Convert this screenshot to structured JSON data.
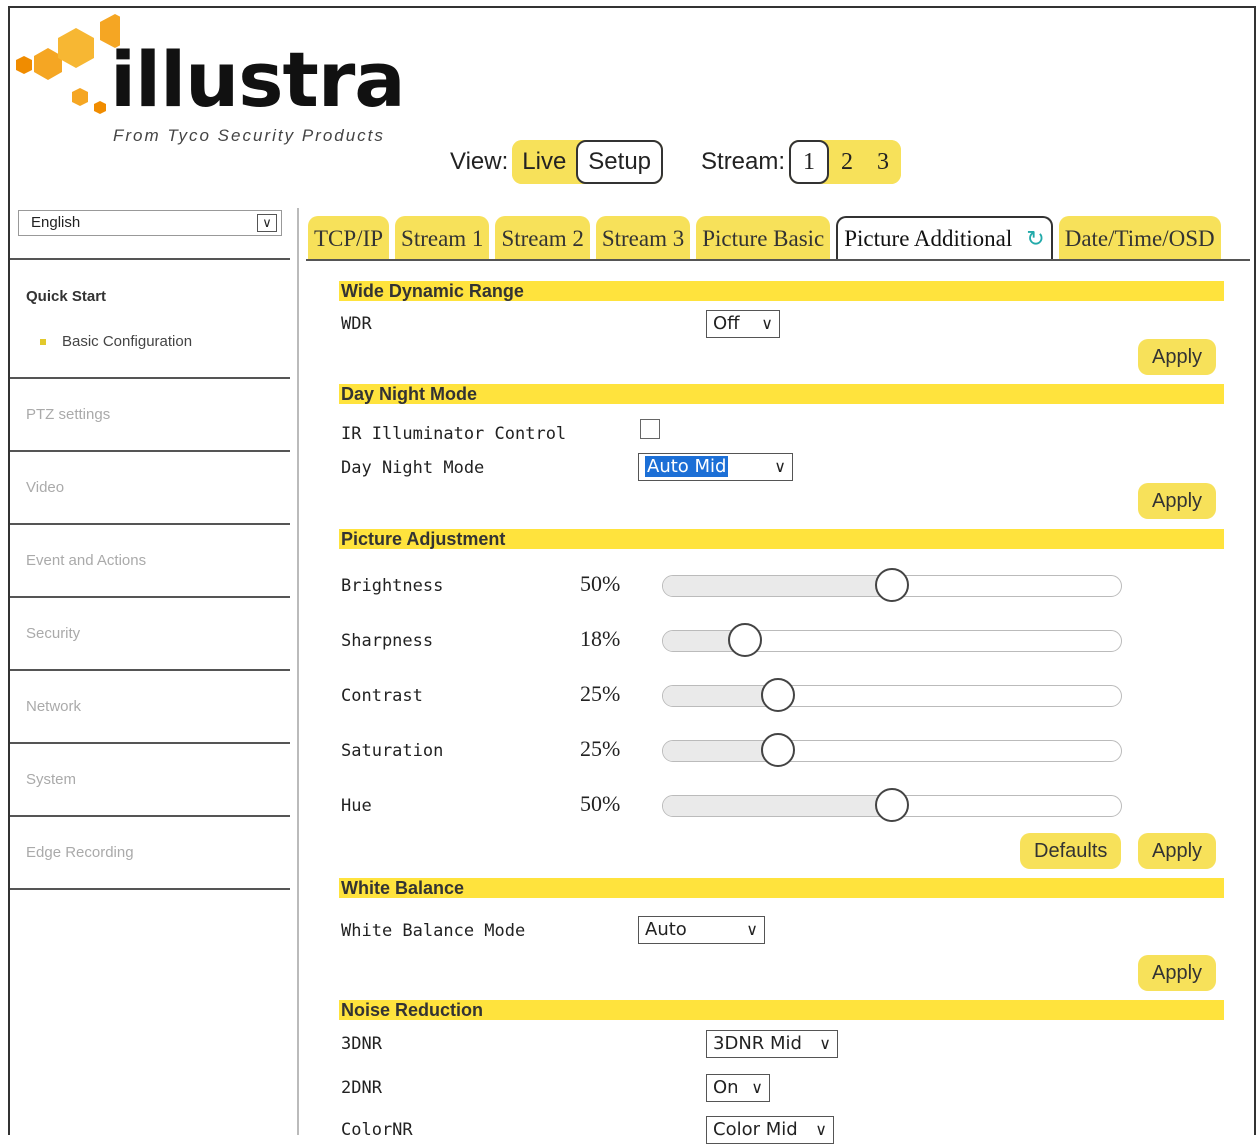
{
  "logo": {
    "word": "illustra",
    "tagline": "From Tyco Security Products"
  },
  "viewbar": {
    "view_label": "View:",
    "live": "Live",
    "setup": "Setup",
    "stream_label": "Stream:",
    "streams": [
      "1",
      "2",
      "3"
    ]
  },
  "sidebar": {
    "language": "English",
    "quick_start": "Quick Start",
    "basic_config": "Basic Configuration",
    "items": [
      "PTZ settings",
      "Video",
      "Event and Actions",
      "Security",
      "Network",
      "System",
      "Edge Recording"
    ]
  },
  "tabs": [
    "TCP/IP",
    "Stream 1",
    "Stream 2",
    "Stream 3",
    "Picture Basic",
    "Picture Additional",
    "Date/Time/OSD"
  ],
  "active_tab": "Picture Additional",
  "sections": {
    "wdr": {
      "title": "Wide Dynamic Range",
      "label": "WDR",
      "value": "Off",
      "apply": "Apply"
    },
    "daynight": {
      "title": "Day Night Mode",
      "ir_label": "IR Illuminator Control",
      "ir_checked": false,
      "mode_label": "Day Night Mode",
      "mode_value": "Auto Mid",
      "apply": "Apply"
    },
    "picture": {
      "title": "Picture Adjustment",
      "sliders": [
        {
          "label": "Brightness",
          "value": "50%",
          "level": 50
        },
        {
          "label": "Sharpness",
          "value": "18%",
          "level": 18
        },
        {
          "label": "Contrast",
          "value": "25%",
          "level": 25
        },
        {
          "label": "Saturation",
          "value": "25%",
          "level": 25
        },
        {
          "label": "Hue",
          "value": "50%",
          "level": 50
        }
      ],
      "defaults": "Defaults",
      "apply": "Apply"
    },
    "wb": {
      "title": "White Balance",
      "label": "White Balance Mode",
      "value": "Auto",
      "apply": "Apply"
    },
    "noise": {
      "title": "Noise Reduction",
      "rows": [
        {
          "label": "3DNR",
          "value": "3DNR Mid"
        },
        {
          "label": "2DNR",
          "value": "On"
        },
        {
          "label": "ColorNR",
          "value": "Color Mid"
        }
      ]
    }
  },
  "colors": {
    "accent": "#f7e15a",
    "section": "#ffe33d",
    "logo_orange": "#f5a623"
  }
}
